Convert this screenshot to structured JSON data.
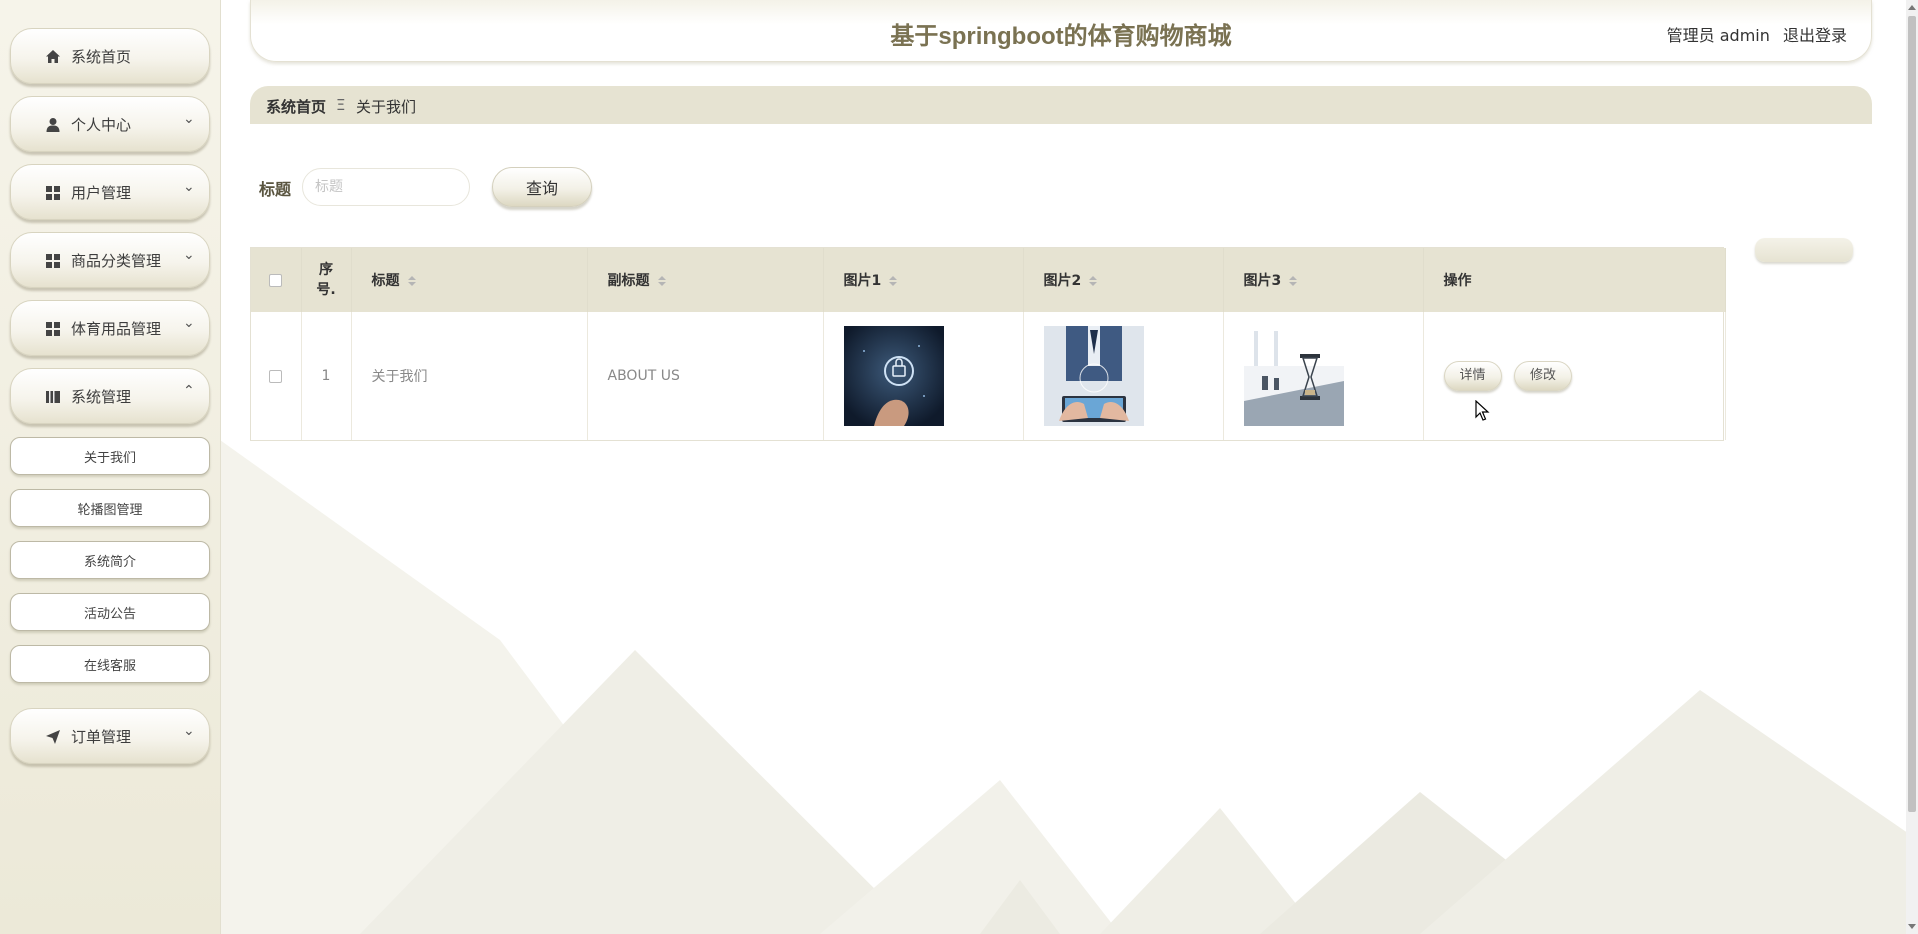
{
  "app": {
    "title": "基于springboot的体育购物商城",
    "user_role": "管理员 admin",
    "logout_label": "退出登录"
  },
  "sidebar": {
    "items": [
      {
        "label": "系统首页",
        "icon": "home-icon",
        "expandable": false
      },
      {
        "label": "个人中心",
        "icon": "user-icon",
        "expandable": true
      },
      {
        "label": "用户管理",
        "icon": "grid-icon",
        "expandable": true
      },
      {
        "label": "商品分类管理",
        "icon": "grid-icon",
        "expandable": true
      },
      {
        "label": "体育用品管理",
        "icon": "grid-icon",
        "expandable": true
      },
      {
        "label": "系统管理",
        "icon": "book-icon",
        "expandable": true,
        "expanded": true
      },
      {
        "label": "订单管理",
        "icon": "send-icon",
        "expandable": true
      }
    ],
    "sub_items": [
      "关于我们",
      "轮播图管理",
      "系统简介",
      "活动公告",
      "在线客服"
    ]
  },
  "breadcrumb": {
    "home": "系统首页",
    "separator": "Ξ",
    "current": "关于我们"
  },
  "search": {
    "label": "标题",
    "placeholder": "标题",
    "value": "",
    "button_label": "查询"
  },
  "table": {
    "columns": [
      "",
      "序号.",
      "标题",
      "副标题",
      "图片1",
      "图片2",
      "图片3",
      "操作"
    ],
    "rows": [
      {
        "index": "1",
        "title": "关于我们",
        "subtitle": "ABOUT US",
        "actions": [
          "详情",
          "修改"
        ]
      }
    ]
  },
  "colors": {
    "accent": "#7a7252",
    "header_bar": "#e6e3d2",
    "sidebar_bg": "#f0eee2"
  }
}
